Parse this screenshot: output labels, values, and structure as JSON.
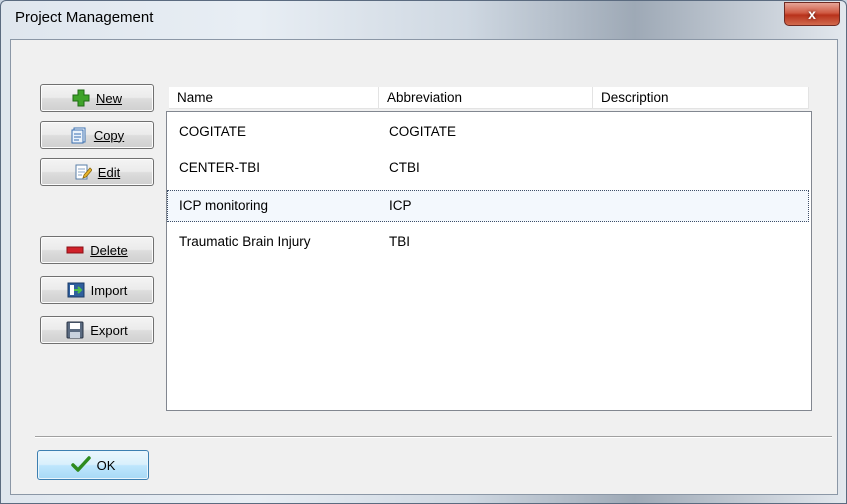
{
  "window": {
    "title": "Project Management",
    "close_symbol": "x"
  },
  "buttons": {
    "new": "New",
    "copy": "Copy",
    "edit": "Edit",
    "delete": "Delete",
    "import": "Import",
    "export": "Export",
    "ok": "OK"
  },
  "table": {
    "columns": [
      "Name",
      "Abbreviation",
      "Description"
    ],
    "rows": [
      {
        "name": "COGITATE",
        "abbreviation": "COGITATE",
        "description": ""
      },
      {
        "name": "CENTER-TBI",
        "abbreviation": "CTBI",
        "description": ""
      },
      {
        "name": "ICP monitoring",
        "abbreviation": "ICP",
        "description": ""
      },
      {
        "name": "Traumatic Brain Injury",
        "abbreviation": "TBI",
        "description": ""
      }
    ],
    "selected_row": "ICP monitoring"
  },
  "icons": {
    "new": "plus-icon",
    "copy": "copy-icon",
    "edit": "edit-icon",
    "delete": "minus-icon",
    "import": "import-icon",
    "export": "save-icon",
    "ok": "checkmark-icon"
  },
  "colors": {
    "plus": "#3fa32a",
    "minus": "#d0212a",
    "check": "#2e8b1f",
    "selection_border": "#3f4f68"
  }
}
